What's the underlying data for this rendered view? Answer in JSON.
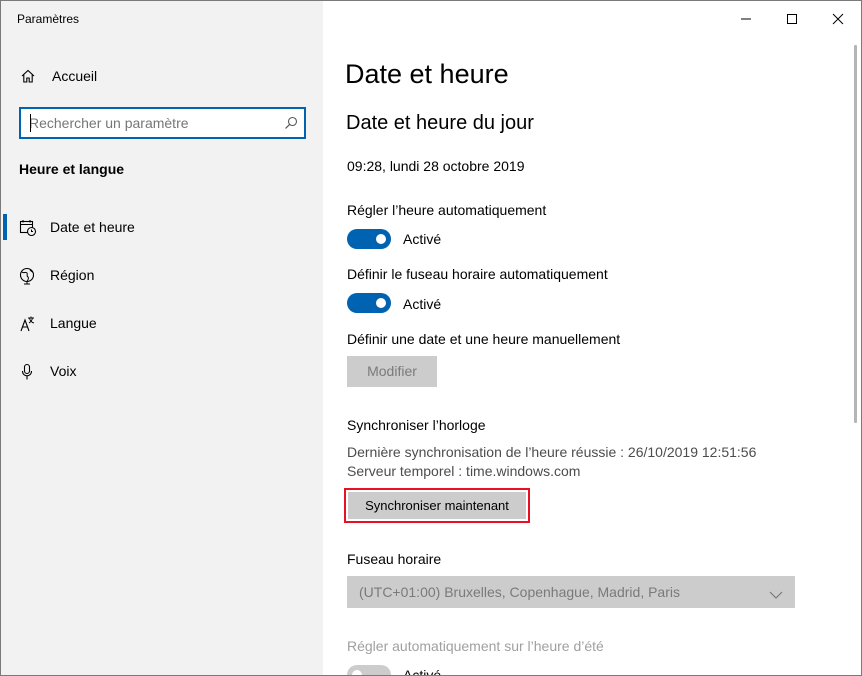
{
  "window": {
    "title": "Paramètres"
  },
  "sidebar": {
    "home_label": "Accueil",
    "search_placeholder": "Rechercher un paramètre",
    "section_heading": "Heure et langue",
    "items": [
      {
        "label": "Date et heure",
        "icon": "calendar-clock-icon",
        "selected": true
      },
      {
        "label": "Région",
        "icon": "globe-icon",
        "selected": false
      },
      {
        "label": "Langue",
        "icon": "language-icon",
        "selected": false
      },
      {
        "label": "Voix",
        "icon": "microphone-icon",
        "selected": false
      }
    ]
  },
  "main": {
    "page_title": "Date et heure",
    "subtitle": "Date et heure du jour",
    "current_datetime": "09:28, lundi 28 octobre 2019",
    "auto_time": {
      "label": "Régler l’heure automatiquement",
      "state": "Activé",
      "on": true
    },
    "auto_timezone": {
      "label": "Définir le fuseau horaire automatiquement",
      "state": "Activé",
      "on": true
    },
    "manual": {
      "label": "Définir une date et une heure manuellement",
      "button": "Modifier"
    },
    "sync": {
      "heading": "Synchroniser l’horloge",
      "last_sync": "Dernière synchronisation de l’heure réussie : 26/10/2019 12:51:56",
      "server": "Serveur temporel : time.windows.com",
      "button": "Synchroniser maintenant"
    },
    "timezone": {
      "label": "Fuseau horaire",
      "value": "(UTC+01:00) Bruxelles, Copenhague, Madrid, Paris"
    },
    "dst": {
      "label": "Régler automatiquement sur l’heure d’été",
      "state": "Activé",
      "on": false
    }
  },
  "colors": {
    "accent": "#0063b1",
    "highlight": "#e81123",
    "sidebar_bg": "#f2f2f2",
    "button_bg": "#cccccc"
  }
}
